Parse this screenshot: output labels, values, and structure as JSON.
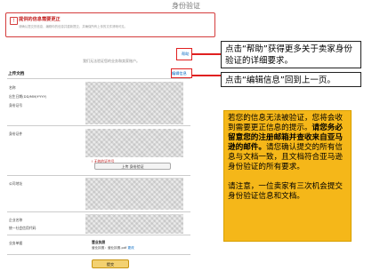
{
  "page": {
    "title": "身份验证"
  },
  "alert": {
    "heading": "提供的信息需要更正",
    "description": "请确认提交的信息，编辑你的信息并重新提交，并确保所有上传的文件清晰可见。"
  },
  "intro": {
    "text": "我们无法验证您的业务和卖家账户。"
  },
  "help_link": "帮助",
  "section": {
    "title": "上传文档",
    "edit_link": "编辑信息"
  },
  "fields": {
    "name": "名称",
    "dob": "出生日期(DD/MM/YYYY)",
    "id_number": "身份证号",
    "id_doc": "身份证件",
    "company_address": "公司地址",
    "company_name": "企业名称",
    "credit_code": "统一社会信用代码",
    "business_docs": "业务单据"
  },
  "id_doc": {
    "error_link": "! 无效的证件号",
    "upload_button": "上传 身份验证"
  },
  "business_docs": {
    "heading": "营业执照",
    "file_prefix": "营业执照：营业执照.pdf",
    "file_link": "更改"
  },
  "submit_button": "提交",
  "callouts": {
    "help": "点击“帮助”获得更多关于卖家身份验证的详细要求。",
    "edit": "点击“编辑信息”回到上一页。"
  },
  "note": {
    "para1_a": "若您的信息无法被验证，您将会收到需要更正信息的提示。",
    "para1_b": "请您务必留意您的注册邮箱并查收来自亚马逊的邮件。",
    "para1_c": "请您确认提交的所有信息与文档一致，且文档符合亚马逊身份验证的所有要求。",
    "para2": "请注意，一位卖家有三次机会提交身份验证信息和文档。"
  },
  "colors": {
    "alert_red": "#c21c1c",
    "link_blue": "#0066c0",
    "note_yellow": "#f5b719",
    "submit_yellow": "#f3d171"
  }
}
